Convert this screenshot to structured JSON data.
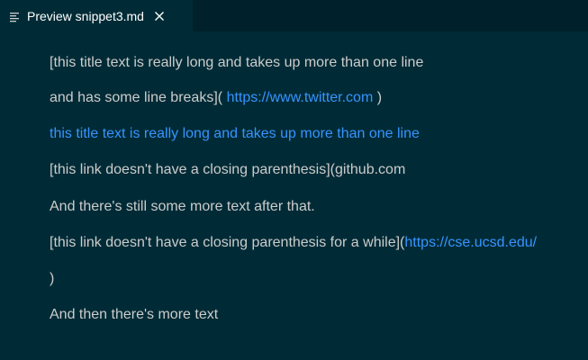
{
  "tab": {
    "icon": "preview-lines-icon",
    "title": "Preview snippet3.md",
    "close_icon": "close-icon"
  },
  "content": {
    "line1": "[this title text is really long and takes up more than one line",
    "line2_prefix": "and has some line breaks](",
    "line2_link": "https://www.twitter.com",
    "line2_suffix": ")",
    "line3_link": "this title text is really long and takes up more than one line",
    "line4": "[this link doesn't have a closing parenthesis](github.com",
    "line5": "And there's still some more text after that.",
    "line6_prefix": "[this link doesn't have a closing parenthesis for a while](",
    "line6_link": "https://cse.ucsd.edu/",
    "line7": ")",
    "line8": "And then there's more text"
  },
  "colors": {
    "background": "#002b36",
    "tabbar": "#00212b",
    "text": "#cccccc",
    "link": "#3794ff"
  }
}
